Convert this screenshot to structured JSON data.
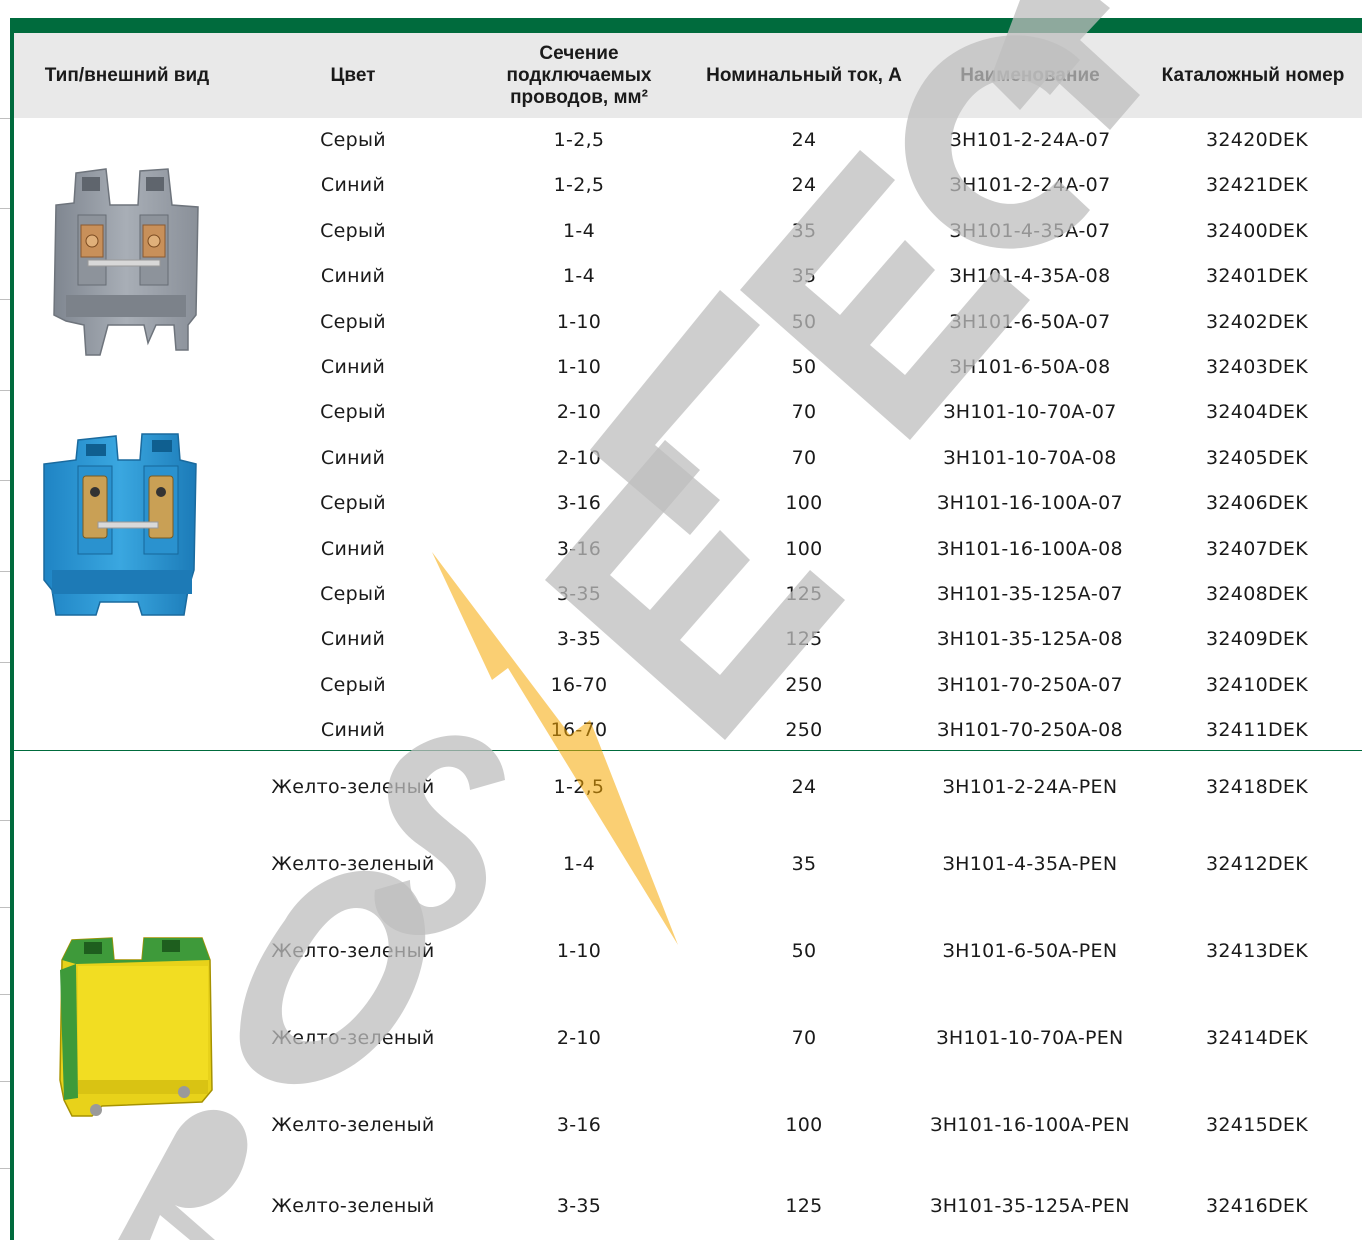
{
  "header": {
    "col_type": "Тип/внешний вид",
    "col_color": "Цвет",
    "col_section": "Сечение\nподключаемых\nпроводов, мм²",
    "col_current": "Номинальный ток, А",
    "col_name": "Наименование",
    "col_catalog": "Каталожный номер"
  },
  "group1": {
    "rows": [
      {
        "color": "Серый",
        "section": "1-2,5",
        "current": "24",
        "name": "ЗН101-2-24А-07",
        "catalog": "32420DEK"
      },
      {
        "color": "Синий",
        "section": "1-2,5",
        "current": "24",
        "name": "ЗН101-2-24А-07",
        "catalog": "32421DEK"
      },
      {
        "color": "Серый",
        "section": "1-4",
        "current": "35",
        "name": "ЗН101-4-35А-07",
        "catalog": "32400DEK"
      },
      {
        "color": "Синий",
        "section": "1-4",
        "current": "35",
        "name": "ЗН101-4-35А-08",
        "catalog": "32401DEK"
      },
      {
        "color": "Серый",
        "section": "1-10",
        "current": "50",
        "name": "ЗН101-6-50А-07",
        "catalog": "32402DEK"
      },
      {
        "color": "Синий",
        "section": "1-10",
        "current": "50",
        "name": "ЗН101-6-50А-08",
        "catalog": "32403DEK"
      },
      {
        "color": "Серый",
        "section": "2-10",
        "current": "70",
        "name": "ЗН101-10-70А-07",
        "catalog": "32404DEK"
      },
      {
        "color": "Синий",
        "section": "2-10",
        "current": "70",
        "name": "ЗН101-10-70А-08",
        "catalog": "32405DEK"
      },
      {
        "color": "Серый",
        "section": "3-16",
        "current": "100",
        "name": "ЗН101-16-100А-07",
        "catalog": "32406DEK"
      },
      {
        "color": "Синий",
        "section": "3-16",
        "current": "100",
        "name": "ЗН101-16-100А-08",
        "catalog": "32407DEK"
      },
      {
        "color": "Серый",
        "section": "3-35",
        "current": "125",
        "name": "ЗН101-35-125А-07",
        "catalog": "32408DEK"
      },
      {
        "color": "Синий",
        "section": "3-35",
        "current": "125",
        "name": "ЗН101-35-125А-08",
        "catalog": "32409DEK"
      },
      {
        "color": "Серый",
        "section": "16-70",
        "current": "250",
        "name": "ЗН101-70-250А-07",
        "catalog": "32410DEK"
      },
      {
        "color": "Синий",
        "section": "16-70",
        "current": "250",
        "name": "ЗН101-70-250А-08",
        "catalog": "32411DEK"
      }
    ]
  },
  "group2": {
    "rows": [
      {
        "color": "Желто-зеленый",
        "section": "1-2,5",
        "current": "24",
        "name": "ЗН101-2-24А-PEN",
        "catalog": "32418DEK"
      },
      {
        "color": "Желто-зеленый",
        "section": "1-4",
        "current": "35",
        "name": "ЗН101-4-35А-PEN",
        "catalog": "32412DEK"
      },
      {
        "color": "Желто-зеленый",
        "section": "1-10",
        "current": "50",
        "name": "ЗН101-6-50А-PEN",
        "catalog": "32413DEK"
      },
      {
        "color": "Желто-зеленый",
        "section": "2-10",
        "current": "70",
        "name": "ЗН101-10-70А-PEN",
        "catalog": "32414DEK"
      },
      {
        "color": "Желто-зеленый",
        "section": "3-16",
        "current": "100",
        "name": "ЗН101-16-100А-PEN",
        "catalog": "32415DEK"
      },
      {
        "color": "Желто-зеленый",
        "section": "3-35",
        "current": "125",
        "name": "ЗН101-35-125А-PEN",
        "catalog": "32416DEK"
      }
    ]
  },
  "images": {
    "gray_block": "grey-terminal-block-photo",
    "blue_block": "blue-terminal-block-photo",
    "yellow_block": "yellow-green-terminal-block-photo"
  },
  "watermark": {
    "text": "ROS ELECT",
    "logo": "lightning-bolt-logo"
  },
  "colors": {
    "accent": "#006b3d",
    "header_bg": "#e9e9e9",
    "watermark_gray": "#bdbdbd",
    "watermark_bolt": "#f5a800"
  }
}
